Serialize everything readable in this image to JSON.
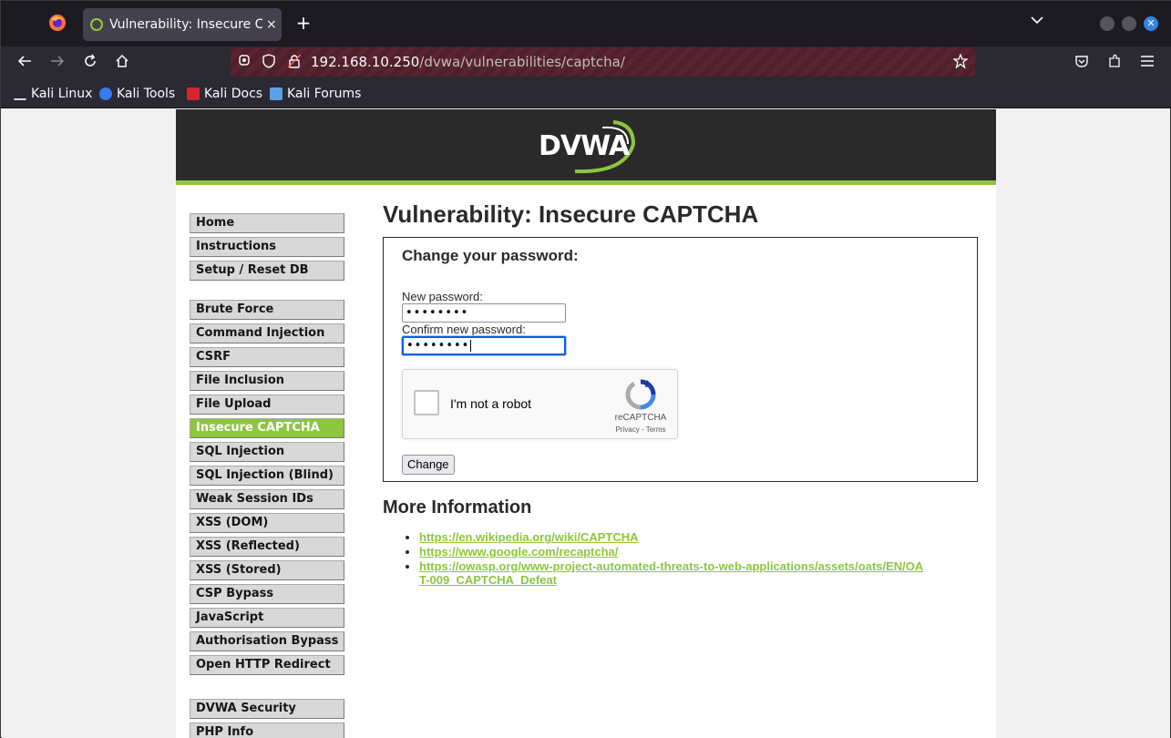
{
  "browser": {
    "tab_title": "Vulnerability: Insecure CA",
    "tab_close": "×",
    "new_tab": "+",
    "url_host": "192.168.10.250",
    "url_path": "/dvwa/vulnerabilities/captcha/",
    "bookmarks": [
      "Kali Linux",
      "Kali Tools",
      "Kali Docs",
      "Kali Forums"
    ]
  },
  "header": {
    "logo_text": "DVWA"
  },
  "menu": {
    "group1": [
      "Home",
      "Instructions",
      "Setup / Reset DB"
    ],
    "group2": [
      "Brute Force",
      "Command Injection",
      "CSRF",
      "File Inclusion",
      "File Upload",
      "Insecure CAPTCHA",
      "SQL Injection",
      "SQL Injection (Blind)",
      "Weak Session IDs",
      "XSS (DOM)",
      "XSS (Reflected)",
      "XSS (Stored)",
      "CSP Bypass",
      "JavaScript",
      "Authorisation Bypass",
      "Open HTTP Redirect"
    ],
    "group3": [
      "DVWA Security",
      "PHP Info"
    ],
    "selected": "Insecure CAPTCHA"
  },
  "main": {
    "title": "Vulnerability: Insecure CAPTCHA",
    "form": {
      "heading": "Change your password:",
      "new_password_label": "New password:",
      "new_password_value": "••••••••",
      "confirm_password_label": "Confirm new password:",
      "confirm_password_value": "••••••••",
      "captcha_text": "I'm not a robot",
      "captcha_brand": "reCAPTCHA",
      "captcha_links": "Privacy - Terms",
      "submit_label": "Change"
    },
    "more_info_title": "More Information",
    "links": [
      "https://en.wikipedia.org/wiki/CAPTCHA",
      "https://www.google.com/recaptcha/",
      "https://owasp.org/www-project-automated-threats-to-web-applications/assets/oats/EN/OAT-009_CAPTCHA_Defeat"
    ]
  },
  "colors": {
    "accent": "#8dc63f",
    "header_bg": "#2a2a2a",
    "urlbar": "#5a2330"
  }
}
